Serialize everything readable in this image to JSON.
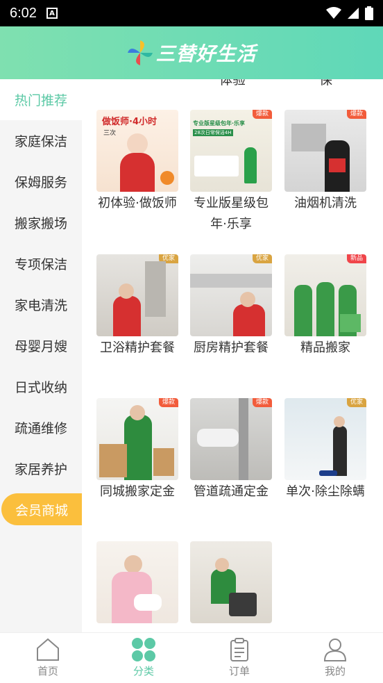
{
  "status": {
    "time": "6:02"
  },
  "header": {
    "logo_text": "三替好生活"
  },
  "sidebar": {
    "items": [
      {
        "label": "热门推荐"
      },
      {
        "label": "家庭保洁"
      },
      {
        "label": "保姆服务"
      },
      {
        "label": "搬家搬场"
      },
      {
        "label": "专项保洁"
      },
      {
        "label": "家电清洗"
      },
      {
        "label": "母婴月嫂"
      },
      {
        "label": "日式收纳"
      },
      {
        "label": "疏通维修"
      },
      {
        "label": "家居养护"
      },
      {
        "label": "会员商城"
      }
    ]
  },
  "content": {
    "cut_labels": [
      "体验",
      "保"
    ],
    "products": [
      {
        "title": "初体验·做饭师",
        "badge": "",
        "thumb_text": "做饭师·4小时",
        "thumb_sub": "三次"
      },
      {
        "title": "专业版星级包年·乐享",
        "badge": "爆款",
        "thumb_text": "专业版星级包年·乐享",
        "thumb_sub": "28次日常保洁4H"
      },
      {
        "title": "油烟机清洗",
        "badge": "爆款",
        "thumb_text": "",
        "thumb_sub": ""
      },
      {
        "title": "卫浴精护套餐",
        "badge": "优家",
        "thumb_text": "",
        "thumb_sub": ""
      },
      {
        "title": "厨房精护套餐",
        "badge": "优家",
        "thumb_text": "",
        "thumb_sub": ""
      },
      {
        "title": "精品搬家",
        "badge": "新品",
        "thumb_text": "",
        "thumb_sub": ""
      },
      {
        "title": "同城搬家定金",
        "badge": "爆款",
        "thumb_text": "",
        "thumb_sub": ""
      },
      {
        "title": "管道疏通定金",
        "badge": "爆款",
        "thumb_text": "",
        "thumb_sub": ""
      },
      {
        "title": "单次·除尘除螨",
        "badge": "优家",
        "thumb_text": "",
        "thumb_sub": ""
      },
      {
        "title": "",
        "badge": "",
        "thumb_text": "",
        "thumb_sub": ""
      },
      {
        "title": "",
        "badge": "",
        "thumb_text": "",
        "thumb_sub": ""
      }
    ]
  },
  "tabbar": {
    "tabs": [
      {
        "label": "首页",
        "icon": "home-icon"
      },
      {
        "label": "分类",
        "icon": "category-icon"
      },
      {
        "label": "订单",
        "icon": "order-icon"
      },
      {
        "label": "我的",
        "icon": "profile-icon"
      }
    ]
  },
  "colors": {
    "accent": "#5cc9a6",
    "vip": "#fbbf3d",
    "badge_hot": "#f25c3b",
    "badge_youjia": "#d9a441",
    "badge_new": "#f0454a"
  }
}
